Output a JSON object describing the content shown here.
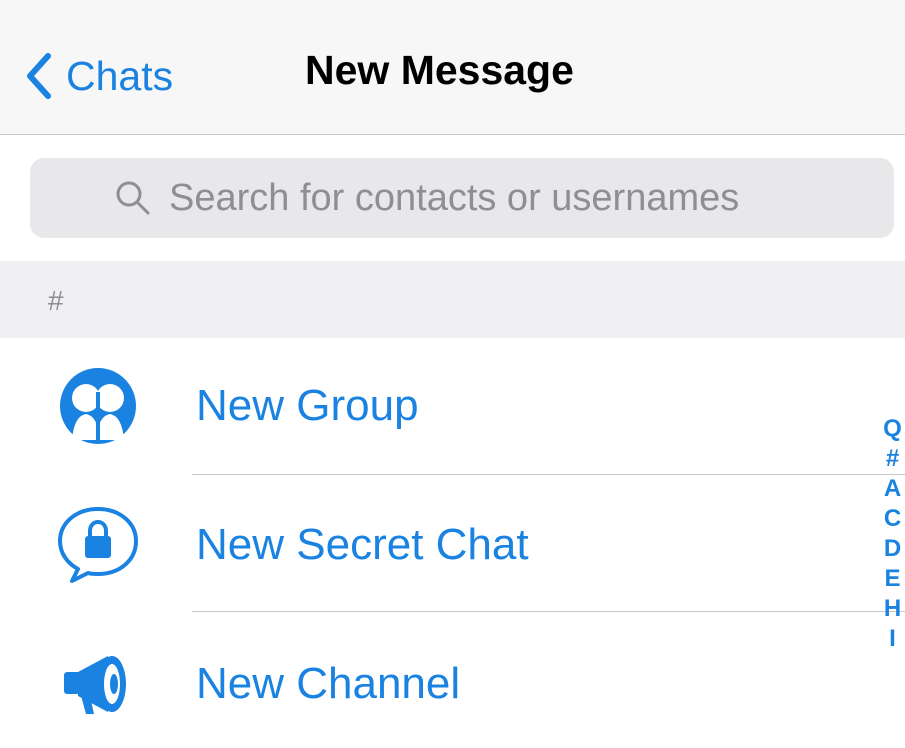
{
  "navbar": {
    "back_label": "Chats",
    "title": "New Message"
  },
  "search": {
    "placeholder": "Search for contacts or usernames"
  },
  "section": {
    "header": "#"
  },
  "actions": [
    {
      "label": "New Group",
      "icon": "group-icon"
    },
    {
      "label": "New Secret Chat",
      "icon": "lock-chat-icon"
    },
    {
      "label": "New Channel",
      "icon": "megaphone-icon"
    }
  ],
  "index": [
    "Q",
    "#",
    "A",
    "C",
    "D",
    "E",
    "H",
    "I"
  ],
  "colors": {
    "accent": "#1a82e0",
    "navbar_bg": "#f7f7f7",
    "search_bg": "#e8e8ea",
    "section_bg": "#efeff4",
    "placeholder": "#8e8e93"
  }
}
